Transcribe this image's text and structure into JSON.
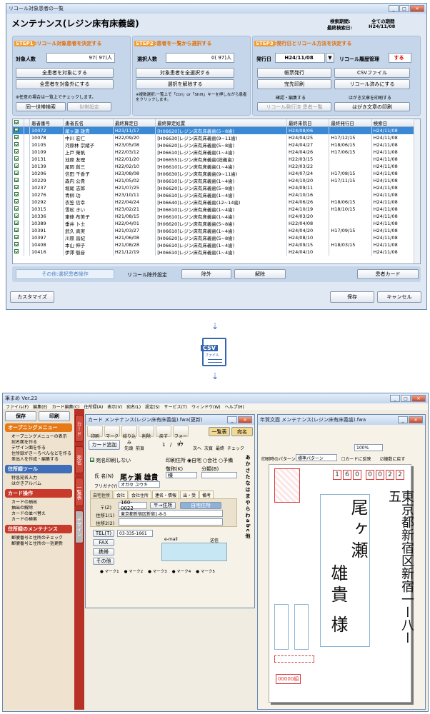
{
  "top": {
    "title": "リコール対象患者の一覧",
    "heading": "メンテナンス(レジン床有床義歯)",
    "period_label": "検索期間:",
    "period_value": "全ての期間",
    "last_label": "最終検索日:",
    "last_value": "H24/11/08",
    "step1": {
      "n": "STEP1",
      "text": ":リコール対象患者を決定する",
      "count_label": "対象人数",
      "count_value": "97(   97)人",
      "btn_all": "全患者を対象にする",
      "btn_none": "全患者を対象外にする",
      "note": "※任意の場合は一覧上でチェックします。",
      "btn_same": "同一世帯検索",
      "btn_setai": "世帯設定"
    },
    "step2": {
      "n": "STEP2",
      "text": ":患者を一覧から選択する",
      "count_label": "選択人数",
      "count_value": "0(   97)人",
      "btn_all": "対象患者を全選択する",
      "btn_none": "選択を解除する",
      "note": "※複数選択:一覧上で「Ctrl」or「Shift」キーを押しながら患者をクリックします。"
    },
    "step3": {
      "n": "STEP3",
      "text": ":発行日とリコール方法を決定する",
      "date_label": "発行日",
      "date_value": "H24/11/08",
      "hist_label": "リコール履歴管理",
      "hist_value": "する",
      "btn_ledger": "帳票発行",
      "btn_csv": "CSVファイル",
      "btn_done": "完先印刷",
      "btn_recalled": "リコール済みにする",
      "confirm_label": "確認・編集する",
      "postcard_label": "はがき文章を印刷する",
      "btn_issued": "リコール発行済 患者一覧",
      "btn_postcard": "はがき文章の印刷"
    },
    "columns": [
      "",
      "",
      "患者番号",
      "患者氏名",
      "最終算定日",
      "最終算定処置",
      "最終来院日",
      "最終発行日",
      "検索日"
    ],
    "rows": [
      [
        "10072",
        "尾ヶ瀬 雄貴",
        "H23/11/17",
        "[H06620]レジン床有床義歯(5~8歯)",
        "H24/08/06",
        "",
        "H24/11/08"
      ],
      [
        "10078",
        "中川 宏仁",
        "H22/09/20",
        "[H06630]レジン床有床義歯(9~11歯)",
        "H24/04/25",
        "H17/12/15",
        "H24/11/08"
      ],
      [
        "10105",
        "河原林 宗緒子",
        "H23/05/08",
        "[H06620]レジン床有床義歯(5~8歯)",
        "H24/04/27",
        "H18/06/15",
        "H24/11/08"
      ],
      [
        "10109",
        "上戸 榮帆",
        "H22/03/12",
        "[H06610]レジン床有床義歯(1~4歯)",
        "H24/04/26",
        "H17/06/15",
        "H24/11/08"
      ],
      [
        "10131",
        "池原 友理",
        "H22/01/20",
        "[H06655]レジン床有床義歯(総義歯)",
        "H22/03/15",
        "",
        "H24/11/08"
      ],
      [
        "10139",
        "尾岡 創三",
        "H22/02/10",
        "[H06610]レジン床有床義歯(1~4歯)",
        "H22/03/22",
        "",
        "H24/11/08"
      ],
      [
        "10206",
        "信田 千香子",
        "H23/08/08",
        "[H06630]レジン床有床義歯(9~11歯)",
        "H24/07/24",
        "H17/08/15",
        "H24/11/08"
      ],
      [
        "10229",
        "森内 公貴",
        "H21/05/02",
        "[H06610]レジン床有床義歯(1~4歯)",
        "H24/10/20",
        "H17/11/15",
        "H24/11/08"
      ],
      [
        "10237",
        "堀尾 志郎",
        "H21/07/25",
        "[H06620]レジン床有床義歯(5~8歯)",
        "H24/09/11",
        "",
        "H24/11/08"
      ],
      [
        "10276",
        "青柳 功",
        "H23/10/11",
        "[H06610]レジン床有床義歯(1~4歯)",
        "H24/10/16",
        "",
        "H24/11/08"
      ],
      [
        "10292",
        "衣笠 信幸",
        "H22/04/24",
        "[H06640]レジン床有床義歯(12~14歯)",
        "H24/06/26",
        "H18/06/15",
        "H24/11/08"
      ],
      [
        "10315",
        "雪松 きい",
        "H23/02/21",
        "[H06610]レジン床有床義歯(1~4歯)",
        "H24/10/19",
        "H18/10/15",
        "H24/11/08"
      ],
      [
        "10336",
        "東條 布美子",
        "H21/08/15",
        "[H06610]レジン床有床義歯(1~4歯)",
        "H24/03/20",
        "",
        "H24/11/08"
      ],
      [
        "10389",
        "垂井 卜士",
        "H22/04/01",
        "[H06620]レジン床有床義歯(5~8歯)",
        "H22/04/08",
        "",
        "H24/11/08"
      ],
      [
        "10391",
        "武久 真実",
        "H21/03/27",
        "[H06610]レジン床有床義歯(1~4歯)",
        "H24/04/20",
        "H17/09/15",
        "H24/11/08"
      ],
      [
        "10397",
        "川原 昌紀",
        "H21/06/08",
        "[H06620]レジン床有床義歯(5~8歯)",
        "H24/08/10",
        "",
        "H24/11/08"
      ],
      [
        "10408",
        "本山 伸子",
        "H21/08/28",
        "[H06610]レジン床有床義歯(1~4歯)",
        "H24/09/15",
        "H18/03/15",
        "H24/11/08"
      ],
      [
        "10416",
        "伊澤 魁音",
        "H21/12/19",
        "[H06610]レジン床有床義歯(1~4歯)",
        "H24/04/10",
        "",
        "H24/11/08"
      ]
    ],
    "other_label": "その他:選択患者操作",
    "exclude_label": "リコール除外設定",
    "btn_exclude": "除外",
    "btn_release": "解除",
    "btn_card": "患者カード",
    "btn_customize": "カスタマイズ",
    "btn_save": "保存",
    "btn_cancel": "キャンセル"
  },
  "csv": {
    "tag": "CSV",
    "sub": "ファイル"
  },
  "bottom": {
    "title": "筆まめ Ver.23",
    "menu": [
      "ファイル(F)",
      "編集(E)",
      "カード編集(C)",
      "住所録(A)",
      "表示(V)",
      "宛名(L)",
      "設定(S)",
      "サービス(T)",
      "ウィンドウ(W)",
      "ヘルプ(H)"
    ],
    "save": "保存",
    "print": "印刷",
    "side": {
      "op_menu": "オープニングメニュー",
      "op_items": [
        "オープニングメニューの表示",
        "宛名面を作る",
        "デザイン面を作る",
        "住所録がきーろべんなどを作る",
        "差出人を作成・編集する"
      ],
      "addr_tool": "住所録ツール",
      "addr_items": [
        "特急宛名入力",
        "はがきアルバム"
      ],
      "card_op": "カード操作",
      "card_items": [
        "カードの抽出",
        "抽出の解除",
        "カードの並べ替え",
        "カードの検索"
      ],
      "maint": "住所録のメンテナンス",
      "maint_items": [
        "郵便番号と住所のチェック",
        "郵便番号と住所の一括更新"
      ]
    },
    "tabs": [
      "カード",
      "宛名",
      "一覧表",
      "デザイン"
    ],
    "card_win": {
      "title": "カード メンテナンス(レジン床有床義歯).fwa(更新)",
      "toolbar": [
        "印刷",
        "マーク",
        "絞り込み",
        "削除",
        "戻す",
        "フォーム"
      ],
      "btn_list": "一覧表",
      "btn_name": "宛名",
      "card_add": "カード追加",
      "first": "先頭",
      "prev": "前頁",
      "page": "1",
      "total": "97",
      "next": "次へ",
      "next_page": "次頁",
      "last": "最終",
      "check": "チェック",
      "no_print": "宛名印刷しない",
      "print_pos": "印刷住所",
      "pos_home": "自宅",
      "pos_work": "会社",
      "pos_spare": "予備",
      "honorific_label": "敬称(K)",
      "honorific": "様",
      "category_label": "分類(B)",
      "name_label": "氏 名(N)",
      "name": "尾ヶ瀬 雄貴",
      "kana_label": "フリガナ(Y)",
      "kana": "オガセ ユウキ",
      "tabs": [
        "自宅住所",
        "会社",
        "会社住所",
        "連名・情報",
        "出・受",
        "備考"
      ],
      "zip_label": "〒(Z)",
      "zip": "160-0022",
      "zip_btn": "〒→住所",
      "addr1_label": "住所1(1)",
      "addr1": "東京都新宿区新宿1-8-5",
      "addr2_label": "住所2(2)",
      "home_addr": "自宅住所",
      "tel_label": "TEL(T)",
      "tel": "03-335-1661",
      "fax": "FAX",
      "mobile": "携帯",
      "other": "その他",
      "email": "e-mail",
      "send": "送信",
      "marks": [
        "マーク1",
        "マーク2",
        "マーク3",
        "マーク4",
        "マーク5"
      ],
      "kana_index": "あかさたなはまやらわabc他"
    },
    "nenga_win": {
      "title": "年賀文面 メンテナンス(レジン床有床義歯).fwa",
      "pattern_label": "印刷時のパターン",
      "pattern": "標準パターン",
      "reflect": "カードに反映",
      "sync": "複数に戻す",
      "zoom": "100%",
      "zip": [
        "1",
        "6",
        "0",
        "0",
        "0",
        "2",
        "2"
      ],
      "addr": "東京都新宿区新宿一ー八ー五",
      "name": "尾ヶ瀬",
      "given": "雄貴",
      "sama": "様",
      "stamp": "00000組"
    }
  }
}
